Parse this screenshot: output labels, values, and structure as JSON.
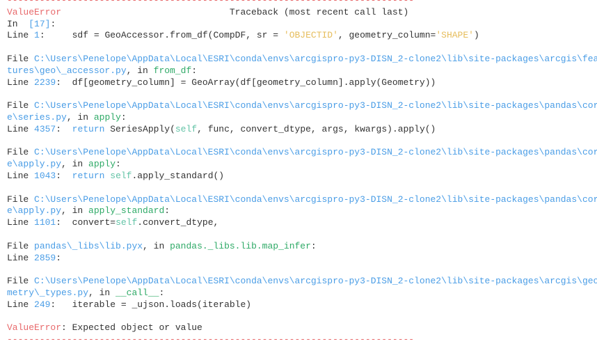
{
  "colors": {
    "red": "#e8696b",
    "blue": "#4a9de6",
    "green": "#2faa67",
    "teal": "#62c3a6",
    "yellow": "#e6bd5c",
    "text": "#333333"
  },
  "traceback": {
    "lines": [
      [
        {
          "t": "---------------------------------------------------------------------------",
          "c": "red"
        }
      ],
      [
        {
          "t": "ValueError",
          "c": "red"
        },
        {
          "t": "                               Traceback (most recent call last)",
          "c": "txt"
        }
      ],
      [
        {
          "t": "In  ",
          "c": "txt"
        },
        {
          "t": "[17]",
          "c": "blue"
        },
        {
          "t": ":",
          "c": "txt"
        }
      ],
      [
        {
          "t": "Line ",
          "c": "txt"
        },
        {
          "t": "1",
          "c": "blue"
        },
        {
          "t": ":     sdf = GeoAccessor.from_df(CompDF, sr = ",
          "c": "txt"
        },
        {
          "t": "'OBJECTID'",
          "c": "yellow"
        },
        {
          "t": ", geometry_column=",
          "c": "txt"
        },
        {
          "t": "'SHAPE'",
          "c": "yellow"
        },
        {
          "t": ")",
          "c": "txt"
        }
      ],
      [],
      [
        {
          "t": "File ",
          "c": "txt"
        },
        {
          "t": "C:\\Users\\Penelope\\AppData\\Local\\ESRI\\conda\\envs\\arcgispro-py3-DISN_2-clone2\\lib\\site-packages\\arcgis\\fea",
          "c": "blue"
        }
      ],
      [
        {
          "t": "tures\\geo\\_accessor.py",
          "c": "blue"
        },
        {
          "t": ", in ",
          "c": "txt"
        },
        {
          "t": "from_df",
          "c": "green"
        },
        {
          "t": ":",
          "c": "txt"
        }
      ],
      [
        {
          "t": "Line ",
          "c": "txt"
        },
        {
          "t": "2239",
          "c": "blue"
        },
        {
          "t": ":  df[geometry_column] = GeoArray(df[geometry_column].apply(Geometry))",
          "c": "txt"
        }
      ],
      [],
      [
        {
          "t": "File ",
          "c": "txt"
        },
        {
          "t": "C:\\Users\\Penelope\\AppData\\Local\\ESRI\\conda\\envs\\arcgispro-py3-DISN_2-clone2\\lib\\site-packages\\pandas\\cor",
          "c": "blue"
        }
      ],
      [
        {
          "t": "e\\series.py",
          "c": "blue"
        },
        {
          "t": ", in ",
          "c": "txt"
        },
        {
          "t": "apply",
          "c": "green"
        },
        {
          "t": ":",
          "c": "txt"
        }
      ],
      [
        {
          "t": "Line ",
          "c": "txt"
        },
        {
          "t": "4357",
          "c": "blue"
        },
        {
          "t": ":  ",
          "c": "txt"
        },
        {
          "t": "return",
          "c": "blue"
        },
        {
          "t": " SeriesApply(",
          "c": "txt"
        },
        {
          "t": "self",
          "c": "teal"
        },
        {
          "t": ", func, convert_dtype, args, kwargs).apply()",
          "c": "txt"
        }
      ],
      [],
      [
        {
          "t": "File ",
          "c": "txt"
        },
        {
          "t": "C:\\Users\\Penelope\\AppData\\Local\\ESRI\\conda\\envs\\arcgispro-py3-DISN_2-clone2\\lib\\site-packages\\pandas\\cor",
          "c": "blue"
        }
      ],
      [
        {
          "t": "e\\apply.py",
          "c": "blue"
        },
        {
          "t": ", in ",
          "c": "txt"
        },
        {
          "t": "apply",
          "c": "green"
        },
        {
          "t": ":",
          "c": "txt"
        }
      ],
      [
        {
          "t": "Line ",
          "c": "txt"
        },
        {
          "t": "1043",
          "c": "blue"
        },
        {
          "t": ":  ",
          "c": "txt"
        },
        {
          "t": "return",
          "c": "blue"
        },
        {
          "t": " ",
          "c": "txt"
        },
        {
          "t": "self",
          "c": "teal"
        },
        {
          "t": ".apply_standard()",
          "c": "txt"
        }
      ],
      [],
      [
        {
          "t": "File ",
          "c": "txt"
        },
        {
          "t": "C:\\Users\\Penelope\\AppData\\Local\\ESRI\\conda\\envs\\arcgispro-py3-DISN_2-clone2\\lib\\site-packages\\pandas\\cor",
          "c": "blue"
        }
      ],
      [
        {
          "t": "e\\apply.py",
          "c": "blue"
        },
        {
          "t": ", in ",
          "c": "txt"
        },
        {
          "t": "apply_standard",
          "c": "green"
        },
        {
          "t": ":",
          "c": "txt"
        }
      ],
      [
        {
          "t": "Line ",
          "c": "txt"
        },
        {
          "t": "1101",
          "c": "blue"
        },
        {
          "t": ":  convert=",
          "c": "txt"
        },
        {
          "t": "self",
          "c": "teal"
        },
        {
          "t": ".convert_dtype,",
          "c": "txt"
        }
      ],
      [],
      [
        {
          "t": "File ",
          "c": "txt"
        },
        {
          "t": "pandas\\_libs\\lib.pyx",
          "c": "blue"
        },
        {
          "t": ", in ",
          "c": "txt"
        },
        {
          "t": "pandas._libs.lib.map_infer",
          "c": "green"
        },
        {
          "t": ":",
          "c": "txt"
        }
      ],
      [
        {
          "t": "Line ",
          "c": "txt"
        },
        {
          "t": "2859",
          "c": "blue"
        },
        {
          "t": ":",
          "c": "txt"
        }
      ],
      [],
      [
        {
          "t": "File ",
          "c": "txt"
        },
        {
          "t": "C:\\Users\\Penelope\\AppData\\Local\\ESRI\\conda\\envs\\arcgispro-py3-DISN_2-clone2\\lib\\site-packages\\arcgis\\geo",
          "c": "blue"
        }
      ],
      [
        {
          "t": "metry\\_types.py",
          "c": "blue"
        },
        {
          "t": ", in ",
          "c": "txt"
        },
        {
          "t": "__call__",
          "c": "green"
        },
        {
          "t": ":",
          "c": "txt"
        }
      ],
      [
        {
          "t": "Line ",
          "c": "txt"
        },
        {
          "t": "249",
          "c": "blue"
        },
        {
          "t": ":   iterable = _ujson.loads(iterable)",
          "c": "txt"
        }
      ],
      [],
      [
        {
          "t": "ValueError",
          "c": "red"
        },
        {
          "t": ": Expected object or value",
          "c": "txt"
        }
      ],
      [
        {
          "t": "---------------------------------------------------------------------------",
          "c": "red"
        }
      ]
    ]
  }
}
